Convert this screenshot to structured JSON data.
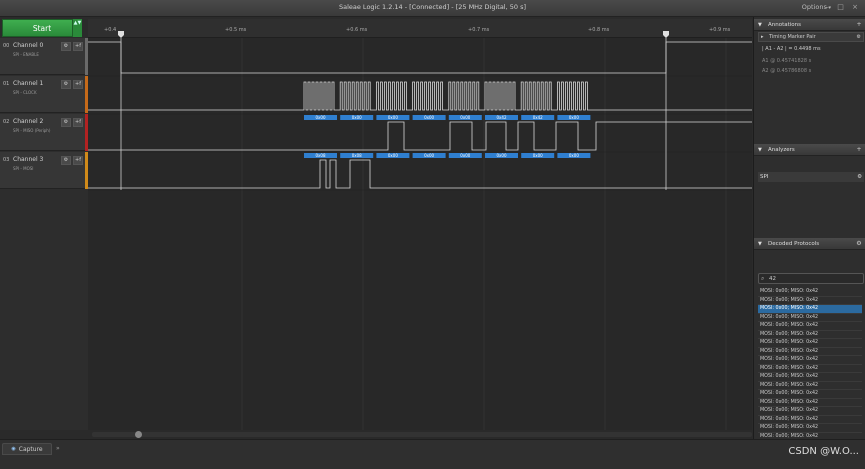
{
  "window": {
    "title": "Saleae Logic 1.2.14 - [Connected] - [25 MHz Digital, 50 s]",
    "options_label": "Options",
    "controls": "– □ ×"
  },
  "start_button": {
    "label": "Start",
    "arrows": "▲▼"
  },
  "channels": [
    {
      "num": "00",
      "name": "Channel 0",
      "sub": "SPI - ENABLE",
      "gear": "⚙",
      "ff": "+f",
      "color": "#6a6a6a"
    },
    {
      "num": "01",
      "name": "Channel 1",
      "sub": "SPI - CLOCK",
      "gear": "⚙",
      "ff": "+f",
      "color": "#c56a1a"
    },
    {
      "num": "02",
      "name": "Channel 2",
      "sub": "SPI - MISO (Periph)",
      "gear": "⚙",
      "ff": "+f",
      "color": "#b22222"
    },
    {
      "num": "03",
      "name": "Channel 3",
      "sub": "SPI - MOSI",
      "gear": "⚙",
      "ff": "+f",
      "color": "#d08a1a"
    }
  ],
  "ruler": {
    "labels": [
      "+0.4",
      "+0.5 ms",
      "+0.6 ms",
      "+0.7 ms",
      "+0.8 ms",
      "+0.9 ms"
    ]
  },
  "decode_miso": [
    "0x00",
    "0x00",
    "0x00",
    "0x00",
    "0x00",
    "0x42",
    "0x42",
    "0x00"
  ],
  "decode_mosi": [
    "0x08",
    "0x08",
    "0x00",
    "0x00",
    "0x00",
    "0x00",
    "0x00",
    "0x00"
  ],
  "annotations": {
    "title": "Annotations",
    "pair_title": "Timing Marker Pair",
    "pair_value": "| A1 - A2 | = 0.4498 ms",
    "a1": "A1  @  0.45741828 s",
    "a2": "A2  @  0.45786808 s"
  },
  "analyzers": {
    "title": "Analyzers",
    "item": "SPI"
  },
  "decoded": {
    "title": "Decoded Protocols",
    "search": "42",
    "row_text": "MOSI: 0x00;  MISO: 0x42",
    "row_count": 19,
    "selected_index": 2
  },
  "capture_tab": {
    "label": "Capture",
    "close": "»"
  },
  "watermark": "CSDN @W.O..."
}
